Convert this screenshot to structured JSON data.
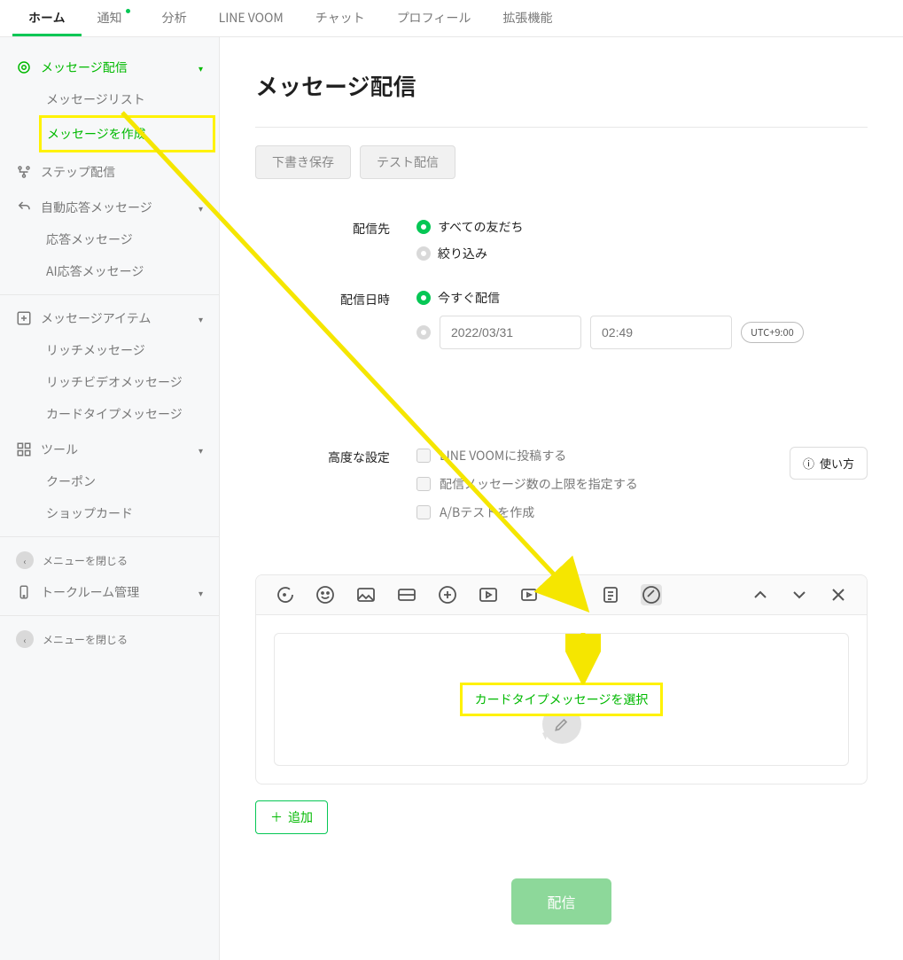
{
  "topnav": {
    "tabs": [
      "ホーム",
      "通知",
      "分析",
      "LINE VOOM",
      "チャット",
      "プロフィール",
      "拡張機能"
    ],
    "active_index": 0,
    "notif_dot_index": 1
  },
  "sidebar": {
    "groups": [
      {
        "label": "メッセージ配信",
        "active": true,
        "expandable": true,
        "items": [
          {
            "label": "メッセージリスト"
          },
          {
            "label": "メッセージを作成",
            "active": true,
            "highlight": true
          }
        ]
      },
      {
        "label": "ステップ配信",
        "expandable": false
      },
      {
        "label": "自動応答メッセージ",
        "expandable": true,
        "items": [
          {
            "label": "応答メッセージ"
          },
          {
            "label": "AI応答メッセージ"
          }
        ]
      }
    ],
    "divider1": true,
    "groups2": [
      {
        "label": "メッセージアイテム",
        "expandable": true,
        "items": [
          {
            "label": "リッチメッセージ"
          },
          {
            "label": "リッチビデオメッセージ"
          },
          {
            "label": "カードタイプメッセージ"
          }
        ]
      },
      {
        "label": "ツール",
        "expandable": true,
        "items": [
          {
            "label": "クーポン"
          },
          {
            "label": "ショップカード"
          }
        ]
      }
    ],
    "collapse1": "メニューを閉じる",
    "talkroom": "トークルーム管理",
    "collapse2": "メニューを閉じる"
  },
  "page": {
    "title": "メッセージ配信",
    "draft_btn": "下書き保存",
    "test_btn": "テスト配信",
    "target_label": "配信先",
    "target_opts": [
      "すべての友だち",
      "絞り込み"
    ],
    "schedule_label": "配信日時",
    "schedule_now": "今すぐ配信",
    "date_placeholder": "2022/03/31",
    "time_placeholder": "02:49",
    "tz": "UTC+9:00",
    "advanced_label": "高度な設定",
    "usage_btn": "使い方",
    "adv_opts": [
      "LINE VOOMに投稿する",
      "配信メッセージ数の上限を指定する",
      "A/Bテストを作成"
    ],
    "card_select": "カードタイプメッセージを選択",
    "add_btn": "追加",
    "send_btn": "配信"
  }
}
